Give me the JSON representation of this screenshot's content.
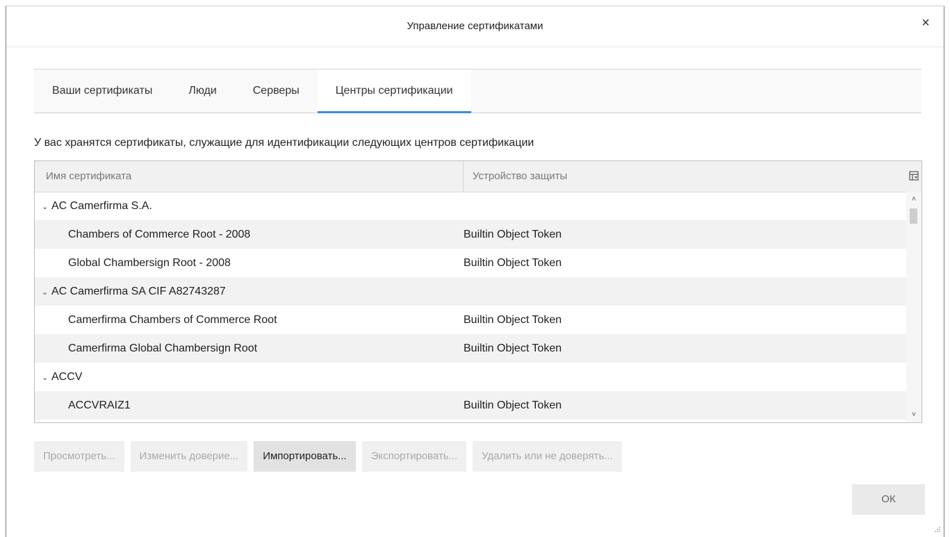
{
  "window": {
    "title": "Управление сертификатами",
    "close_glyph": "×"
  },
  "tabs": [
    {
      "label": "Ваши сертификаты",
      "active": false
    },
    {
      "label": "Люди",
      "active": false
    },
    {
      "label": "Серверы",
      "active": false
    },
    {
      "label": "Центры сертификации",
      "active": true
    }
  ],
  "description": "У вас хранятся сертификаты, служащие для идентификации следующих центров сертификации",
  "table": {
    "columns": [
      "Имя сертификата",
      "Устройство защиты"
    ],
    "rows": [
      {
        "type": "group",
        "name": "AC Camerfirma S.A.",
        "device": "",
        "twisty": "⌄"
      },
      {
        "type": "child",
        "name": "Chambers of Commerce Root - 2008",
        "device": "Builtin Object Token"
      },
      {
        "type": "child",
        "name": "Global Chambersign Root - 2008",
        "device": "Builtin Object Token"
      },
      {
        "type": "group",
        "name": "AC Camerfirma SA CIF A82743287",
        "device": "",
        "twisty": "⌄"
      },
      {
        "type": "child",
        "name": "Camerfirma Chambers of Commerce Root",
        "device": "Builtin Object Token"
      },
      {
        "type": "child",
        "name": "Camerfirma Global Chambersign Root",
        "device": "Builtin Object Token"
      },
      {
        "type": "group",
        "name": "ACCV",
        "device": "",
        "twisty": "⌄"
      },
      {
        "type": "child",
        "name": "ACCVRAIZ1",
        "device": "Builtin Object Token"
      }
    ]
  },
  "buttons": [
    {
      "label": "Просмотреть...",
      "enabled": false
    },
    {
      "label": "Изменить доверие...",
      "enabled": false
    },
    {
      "label": "Импортировать...",
      "enabled": true
    },
    {
      "label": "Экспортировать...",
      "enabled": false
    },
    {
      "label": "Удалить или не доверять...",
      "enabled": false
    }
  ],
  "ok_label": "ОК",
  "scroll": {
    "up": "˄",
    "down": "˅"
  },
  "icons": {
    "column_picker": "column-picker-icon",
    "twisty": "chevron-down-icon",
    "resize": "resize-grip-icon"
  }
}
